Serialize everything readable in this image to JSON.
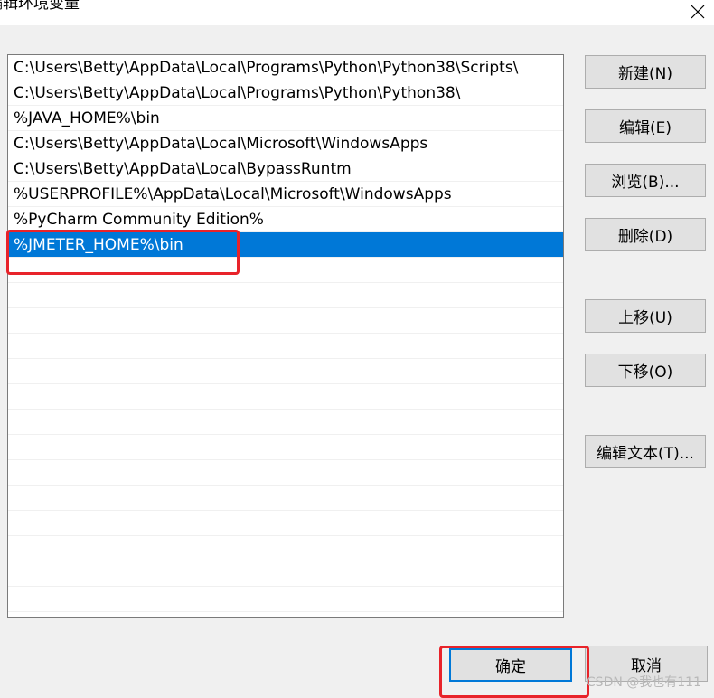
{
  "window": {
    "title": "编辑环境变量",
    "close_icon": "close-icon"
  },
  "paths": [
    "C:\\Users\\Betty\\AppData\\Local\\Programs\\Python\\Python38\\Scripts\\",
    "C:\\Users\\Betty\\AppData\\Local\\Programs\\Python\\Python38\\",
    "%JAVA_HOME%\\bin",
    "C:\\Users\\Betty\\AppData\\Local\\Microsoft\\WindowsApps",
    "C:\\Users\\Betty\\AppData\\Local\\BypassRuntm",
    "%USERPROFILE%\\AppData\\Local\\Microsoft\\WindowsApps",
    "%PyCharm Community Edition%",
    "%JMETER_HOME%\\bin",
    "",
    "",
    "",
    "",
    "",
    "",
    "",
    "",
    "",
    "",
    "",
    "",
    "",
    ""
  ],
  "selected_index": 7,
  "buttons": {
    "new": "新建(N)",
    "edit": "编辑(E)",
    "browse": "浏览(B)...",
    "delete": "删除(D)",
    "move_up": "上移(U)",
    "move_down": "下移(O)",
    "edit_text": "编辑文本(T)...",
    "ok": "确定",
    "cancel": "取消"
  },
  "watermark": "CSDN @我也有111",
  "colors": {
    "selection": "#0078d7",
    "highlight_box": "#e8232a"
  }
}
